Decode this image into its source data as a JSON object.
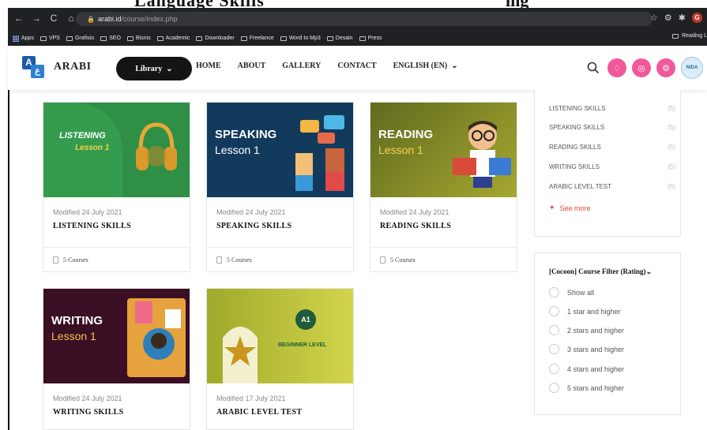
{
  "top_strip": {
    "left_text": "Language Skills",
    "right_text": "ing"
  },
  "browser": {
    "url_host": "arabi.id",
    "url_path": "/course/index.php",
    "bookmarks": [
      "Apps",
      "VPS",
      "Grafisio",
      "SEO",
      "Bisnis",
      "Academic",
      "Downloader",
      "Freelance",
      "Word to Mp3",
      "Desain",
      "Press"
    ],
    "reading_list": "Reading L"
  },
  "header": {
    "logo_text": "ARABI",
    "library_label": "Library",
    "menu": [
      "HOME",
      "ABOUT",
      "GALLERY",
      "CONTACT"
    ],
    "language": "ENGLISH (EN)",
    "seal_text": "NIDA"
  },
  "courses": [
    {
      "thumb_title": "LISTENING",
      "thumb_sub": "Lesson 1",
      "modified": "Modified 24 July 2021",
      "title": "LISTENING SKILLS",
      "count": "5 Courses"
    },
    {
      "thumb_title": "SPEAKING",
      "thumb_sub": "Lesson 1",
      "modified": "Modified 24 July 2021",
      "title": "SPEAKING SKILLS",
      "count": "5 Courses"
    },
    {
      "thumb_title": "READING",
      "thumb_sub": "Lesson 1",
      "modified": "Modified 24 July 2021",
      "title": "READING SKILLS",
      "count": "5 Courses"
    },
    {
      "thumb_title": "WRITING",
      "thumb_sub": "Lesson 1",
      "modified": "Modified 24 July 2021",
      "title": "WRITING SKILLS",
      "count": ""
    },
    {
      "thumb_title": "BEGINNER LEVEL",
      "thumb_badge": "A1",
      "modified": "Modified 17 July 2021",
      "title": "ARABIC LEVEL TEST",
      "count": ""
    }
  ],
  "sidebar": {
    "categories": [
      {
        "name": "LISTENING SKILLS",
        "count": "(5)"
      },
      {
        "name": "SPEAKING SKILLS",
        "count": "(5)"
      },
      {
        "name": "READING SKILLS",
        "count": "(5)"
      },
      {
        "name": "WRITING SKILLS",
        "count": "(5)"
      },
      {
        "name": "ARABIC LEVEL TEST",
        "count": "(5)"
      }
    ],
    "see_more": "See more",
    "filter_title": "[Cocoon] Course Filter (Rating)",
    "filter_options": [
      "Show all",
      "1 star and higher",
      "2 stars and higher",
      "3 stars and higher",
      "4 stars and higher",
      "5 stars and higher"
    ]
  },
  "colors": {
    "pink": "#f0589a",
    "accent_red": "#e8413c",
    "dark_btn": "#141414"
  }
}
